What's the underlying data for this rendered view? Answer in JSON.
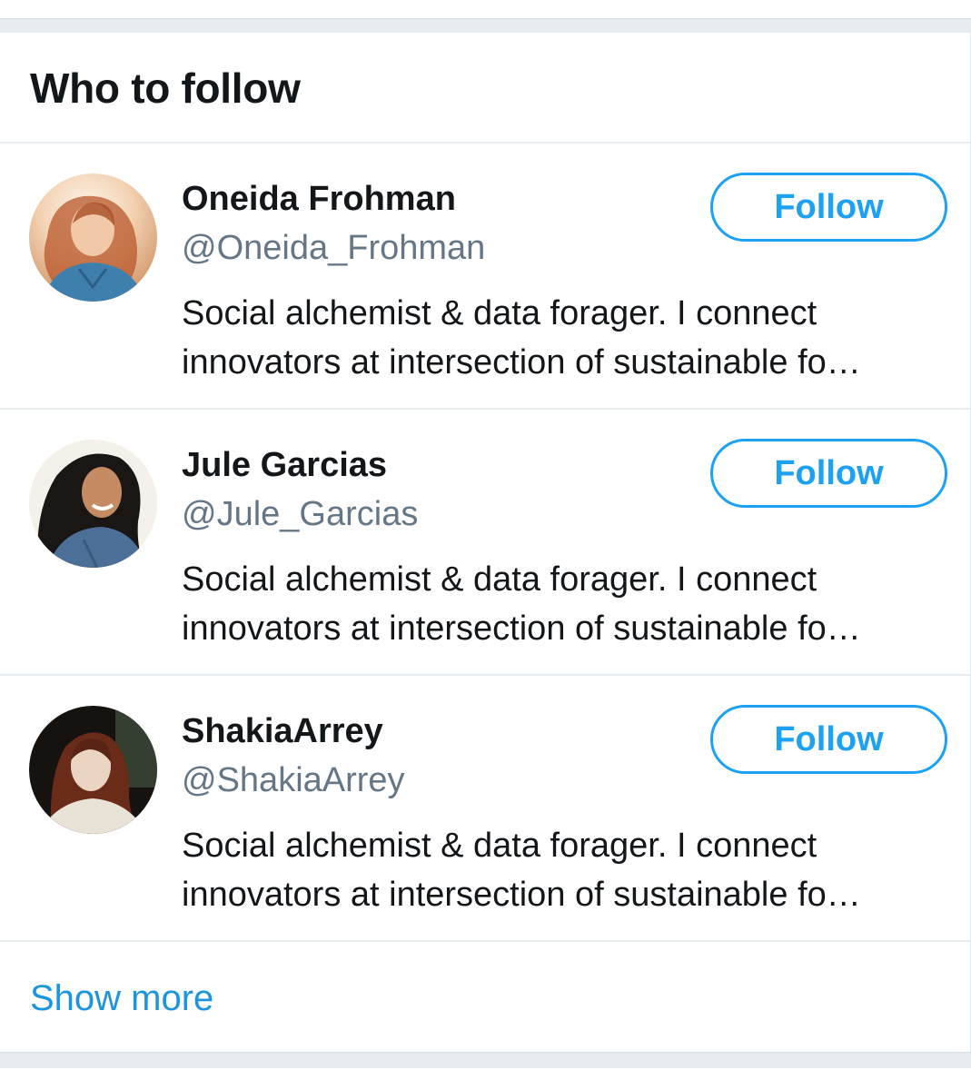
{
  "widget": {
    "title": "Who to follow",
    "show_more_label": "Show more"
  },
  "users": [
    {
      "name": "Oneida Frohman",
      "handle": "@Oneida_Frohman",
      "bio_line1": "Social alchemist & data forager. I connect",
      "bio_line2": "innovators at intersection of sustainable fo…",
      "follow_label": "Follow",
      "avatar_icon": "avatar-photo-woman-red-hair"
    },
    {
      "name": "Jule Garcias",
      "handle": "@Jule_Garcias",
      "bio_line1": "Social alchemist & data forager. I connect",
      "bio_line2": "innovators at intersection of sustainable fo…",
      "follow_label": "Follow",
      "avatar_icon": "avatar-photo-woman-dark-hair"
    },
    {
      "name": "ShakiaArrey",
      "handle": "@ShakiaArrey",
      "bio_line1": "Social alchemist & data forager. I connect",
      "bio_line2": "innovators at intersection of sustainable fo…",
      "follow_label": "Follow",
      "avatar_icon": "avatar-photo-woman-auburn-hair"
    }
  ],
  "colors": {
    "accent": "#1da1f2",
    "link": "#1b95e0",
    "text_primary": "#14171a",
    "text_secondary": "#657786",
    "divider": "#e6ecf0"
  }
}
